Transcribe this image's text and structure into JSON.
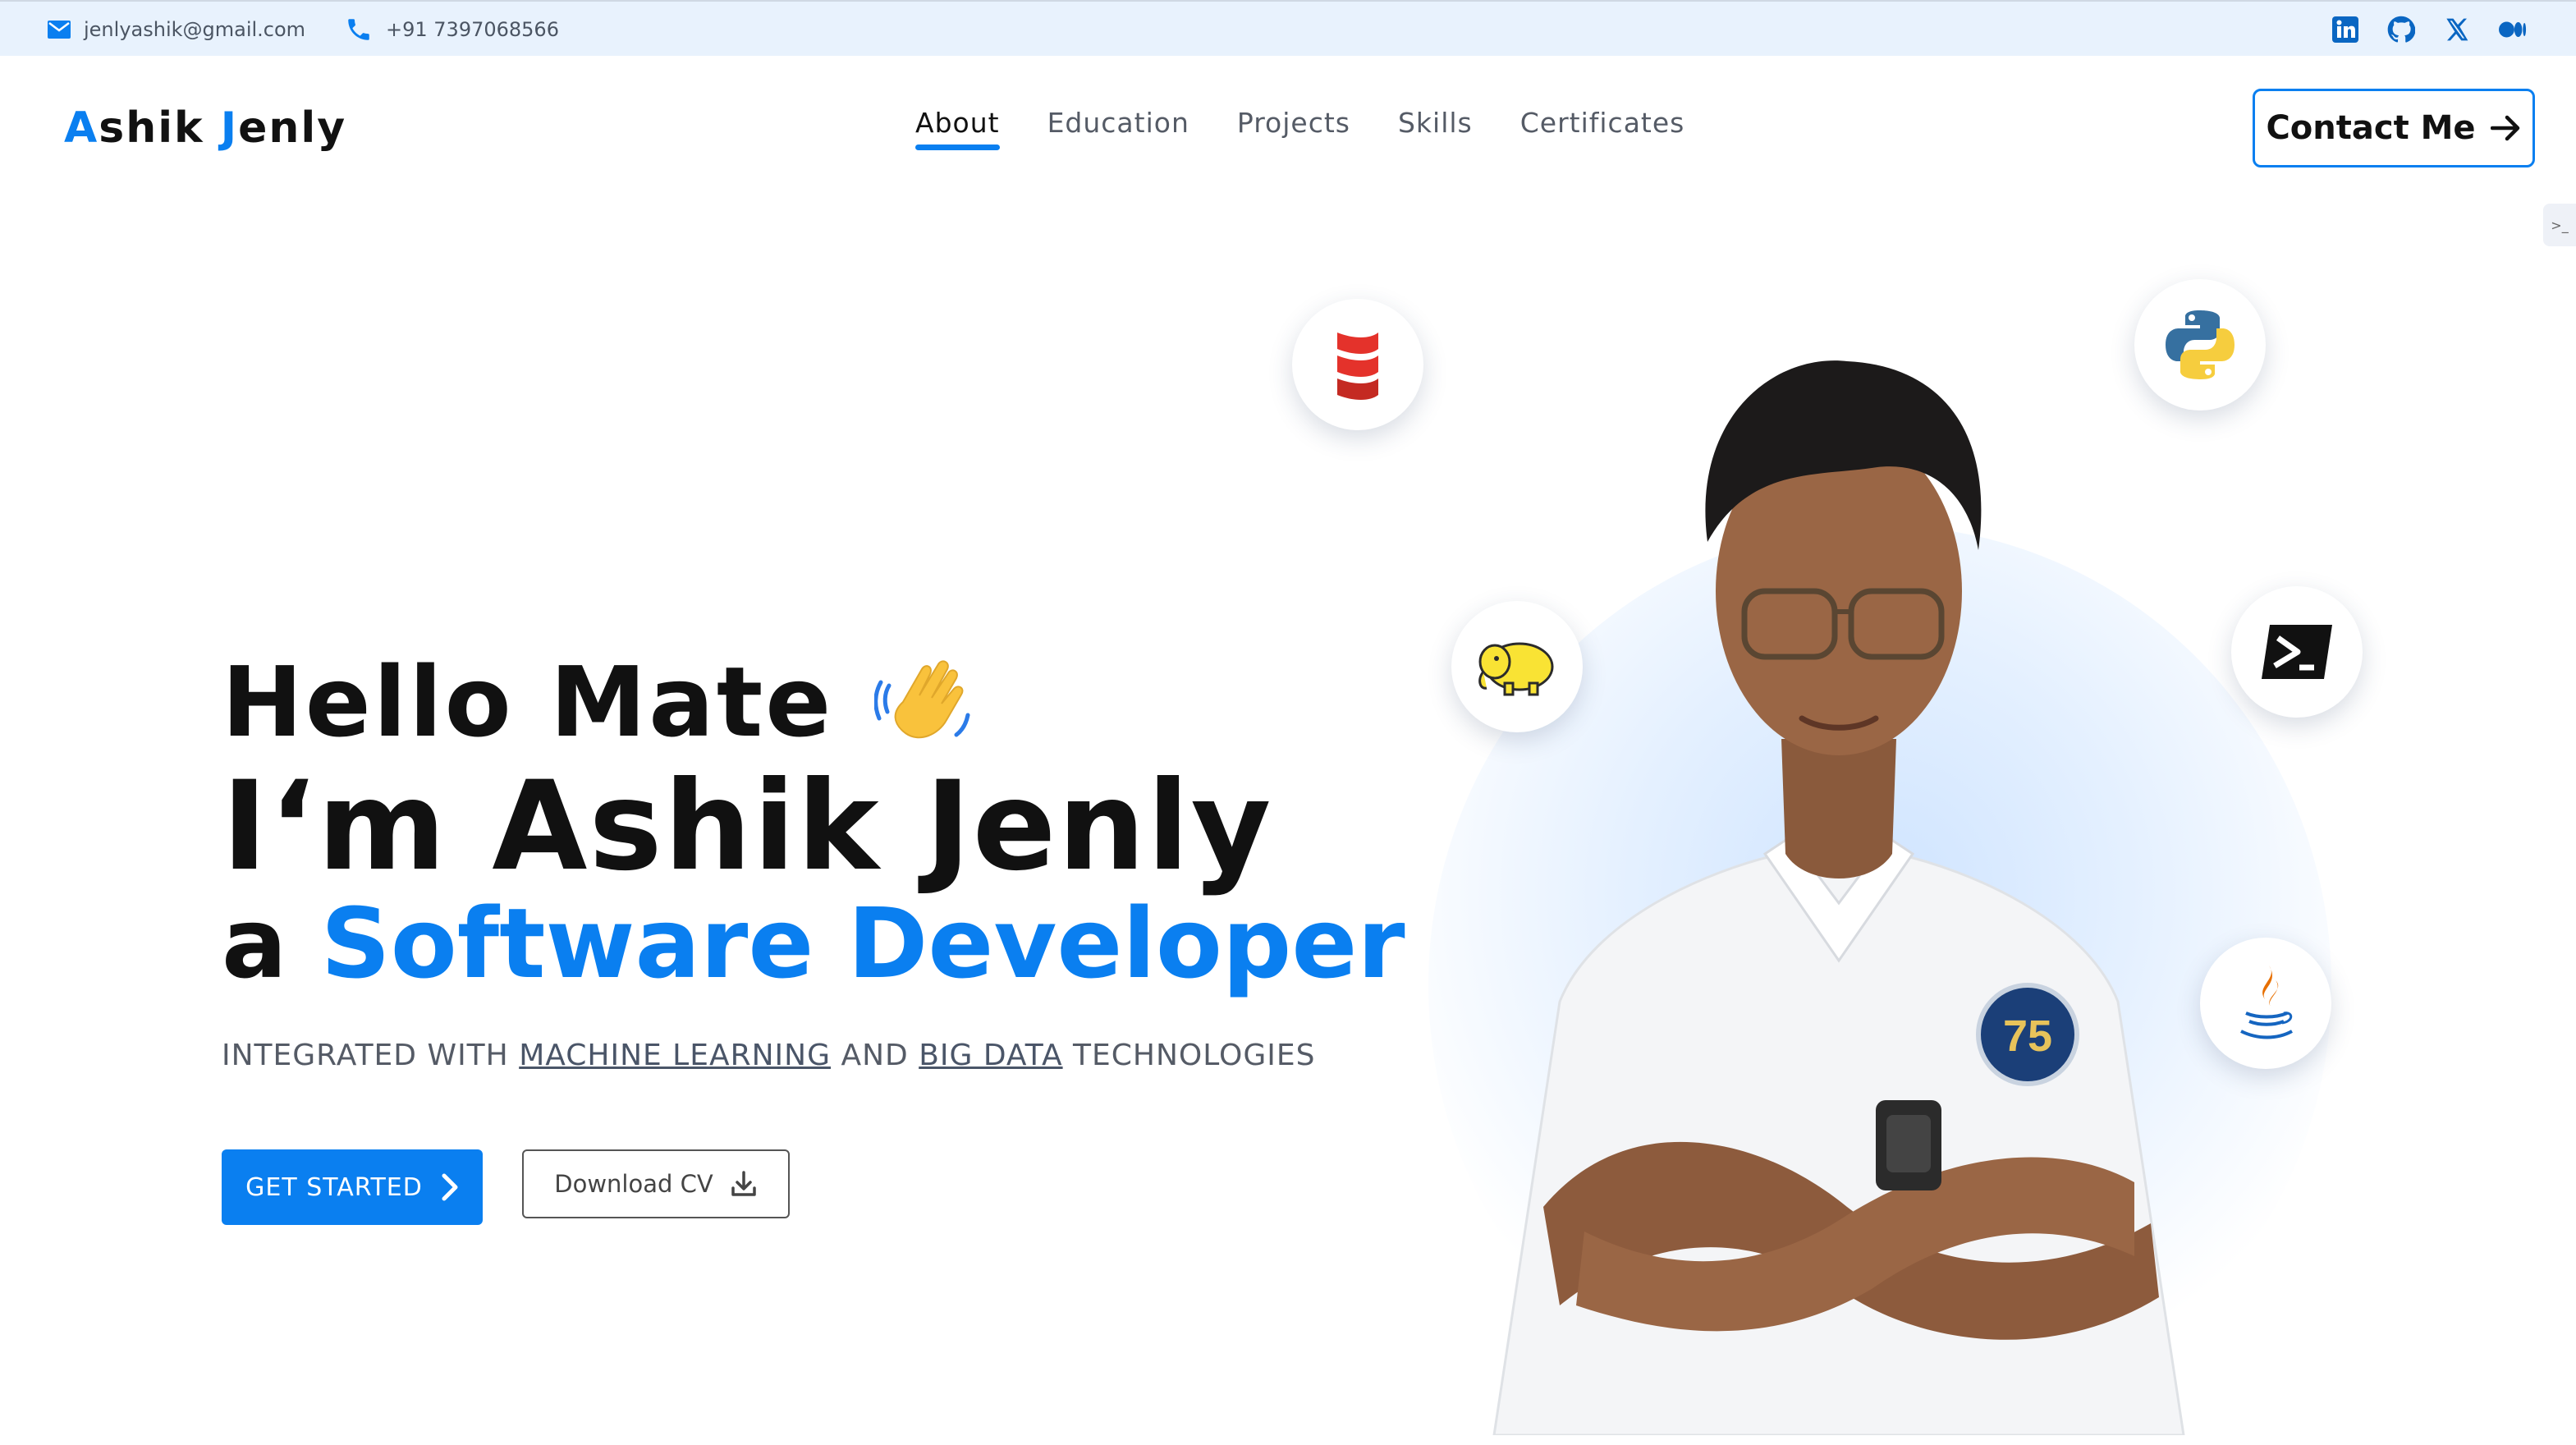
{
  "topbar": {
    "email": "jenlyashik@gmail.com",
    "phone": "+91 7397068566",
    "socials": [
      "linkedin-icon",
      "github-icon",
      "x-icon",
      "medium-icon"
    ]
  },
  "nav": {
    "logo_first": "A",
    "logo_first_rest": "shik ",
    "logo_second": "J",
    "logo_second_rest": "enly",
    "items": [
      "About",
      "Education",
      "Projects",
      "Skills",
      "Certificates"
    ],
    "active": "About",
    "contact_label": "Contact Me",
    "side_tab": ">_"
  },
  "hero": {
    "hello": "Hello Mate",
    "name": "I‘m Ashik Jenly",
    "role_prefix": "a ",
    "role_highlight": "Software Developer",
    "tagline_1": "INTEGRATED WITH ",
    "tagline_link_1": "MACHINE LEARNING",
    "tagline_2": " AND ",
    "tagline_link_2": "BIG DATA",
    "tagline_3": " TECHNOLOGIES",
    "start_label": "GET STARTED",
    "cv_label": "Download CV"
  },
  "skill_bubbles": [
    "scala-icon",
    "python-icon",
    "hadoop-icon",
    "terminal-icon",
    "java-icon"
  ],
  "colors": {
    "accent": "#0a7ff0",
    "topbar": "#e8f2fd",
    "text": "#111111",
    "muted": "#555b66"
  }
}
